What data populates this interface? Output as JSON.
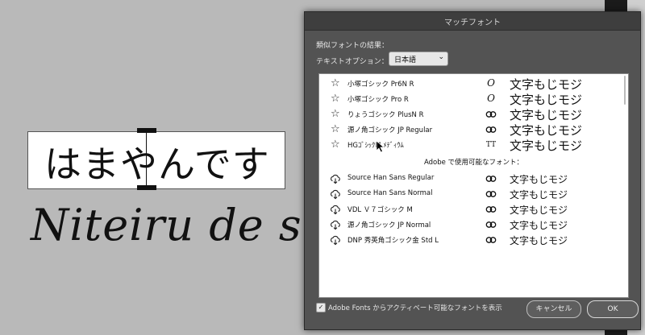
{
  "canvas": {
    "textbox_text": "はまやんです",
    "script_text": "Niteiru de sho"
  },
  "dialog": {
    "title": "マッチフォント",
    "similar_label": "類似フォントの結果：",
    "option_label": "テキストオプション：",
    "language_select": "日本語",
    "installed_fonts": [
      {
        "name": "小塚ゴシック Pr6N R",
        "type_icon": "italic-o-icon",
        "sample": "文字もじモジ"
      },
      {
        "name": "小塚ゴシック Pro R",
        "type_icon": "italic-o-icon",
        "sample": "文字もじモジ"
      },
      {
        "name": "りょうゴシック PlusN R",
        "type_icon": "creative-cloud-icon",
        "sample": "文字もじモジ"
      },
      {
        "name": "源ノ角ゴシック JP Regular",
        "type_icon": "creative-cloud-icon",
        "sample": "文字もじモジ"
      },
      {
        "name": "HGｺﾞｼｯｸM ﾒﾃﾞｨｳﾑ",
        "type_icon": "truetype-icon",
        "sample": "文字もじモジ"
      }
    ],
    "adobe_section_label": "Adobe で使用可能なフォント：",
    "adobe_fonts": [
      {
        "name": "Source Han Sans Regular",
        "sample": "文字もじモジ"
      },
      {
        "name": "Source Han Sans Normal",
        "sample": "文字もじモジ"
      },
      {
        "name": "VDL Ｖ７ゴシック M",
        "sample": "文字もじモジ"
      },
      {
        "name": "源ノ角ゴシック JP Normal",
        "sample": "文字もじモジ"
      },
      {
        "name": "DNP 秀英角ゴシック金 Std L",
        "sample": "文字もじモジ"
      }
    ],
    "checkbox_label": "Adobe Fonts からアクティベート可能なフォントを表示",
    "checkbox_checked": true,
    "cancel_label": "キャンセル",
    "ok_label": "OK"
  }
}
